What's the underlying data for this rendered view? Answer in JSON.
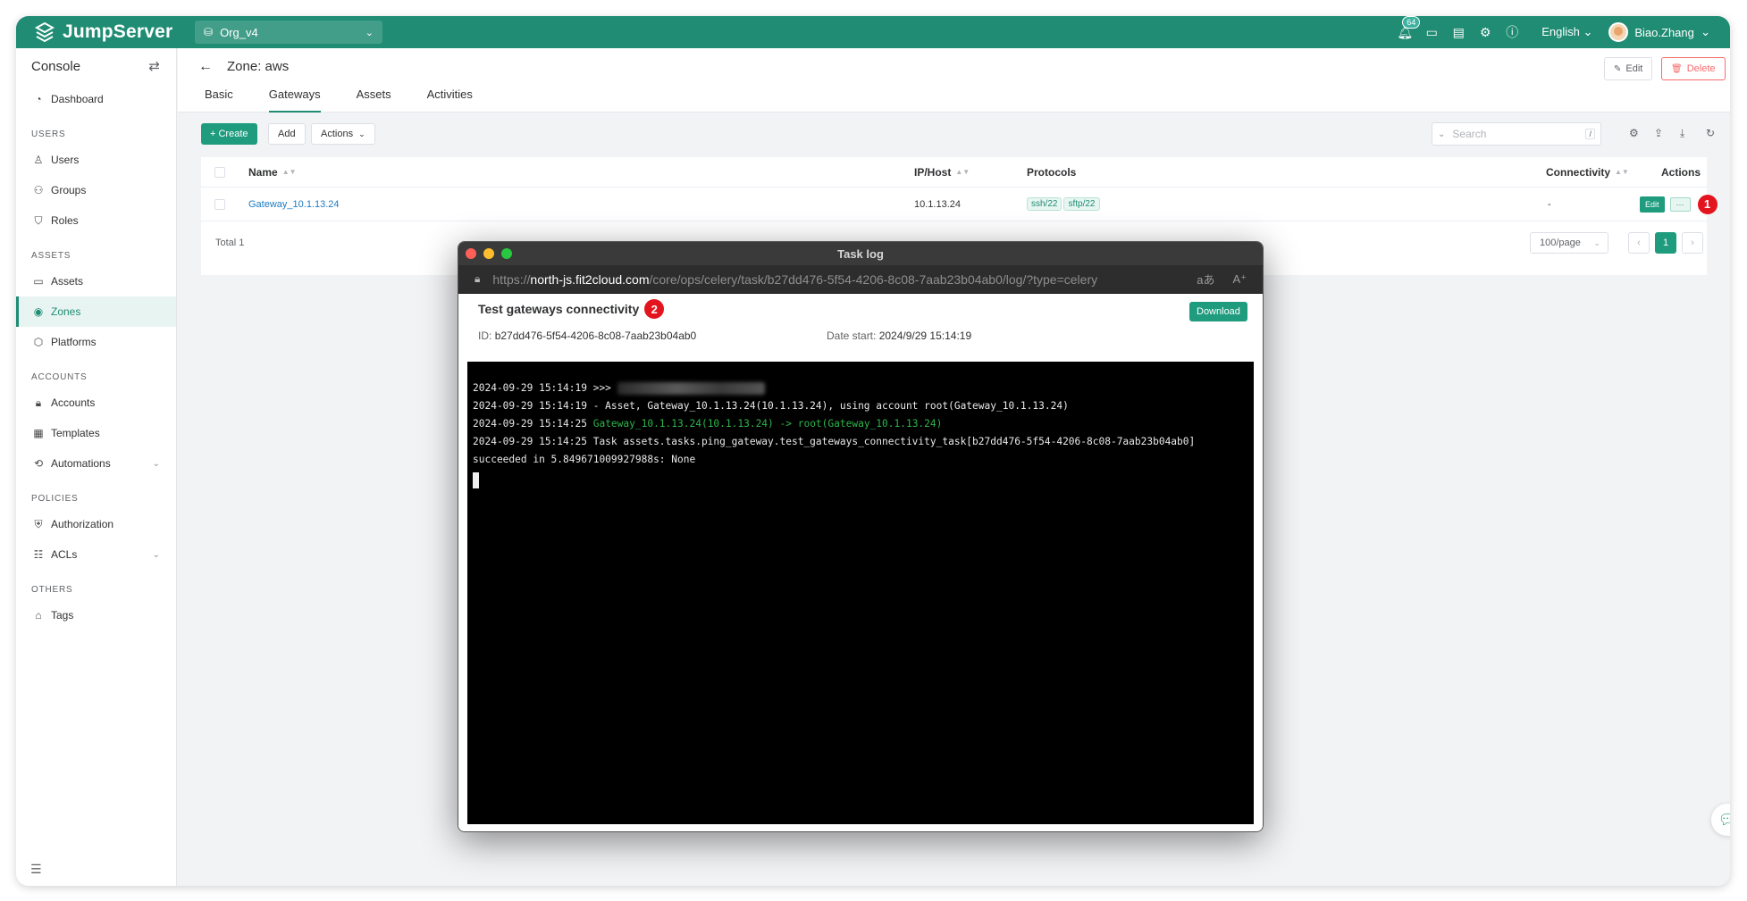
{
  "app": {
    "brand": "JumpServer",
    "org": "Org_v4"
  },
  "topbar": {
    "notification_count": "64",
    "language": "English",
    "user_name": "Biao.Zhang"
  },
  "sidebar": {
    "title": "Console",
    "groups": {
      "users": "USERS",
      "assets": "ASSETS",
      "accounts": "ACCOUNTS",
      "policies": "POLICIES",
      "others": "OTHERS"
    },
    "items": {
      "dashboard": "Dashboard",
      "users": "Users",
      "groups": "Groups",
      "roles": "Roles",
      "assets": "Assets",
      "zones": "Zones",
      "platforms": "Platforms",
      "accounts": "Accounts",
      "templates": "Templates",
      "automations": "Automations",
      "authorization": "Authorization",
      "acls": "ACLs",
      "tags": "Tags"
    }
  },
  "header": {
    "title": "Zone: aws",
    "tabs": [
      "Basic",
      "Gateways",
      "Assets",
      "Activities"
    ],
    "edit_label": "Edit",
    "delete_label": "Delete"
  },
  "toolbar": {
    "create_label": "+ Create",
    "add_label": "Add",
    "actions_label": "Actions",
    "search_placeholder": "Search",
    "search_shortcut": "/"
  },
  "table": {
    "columns": {
      "name": "Name",
      "ip": "IP/Host",
      "protocols": "Protocols",
      "connectivity": "Connectivity",
      "actions": "Actions"
    },
    "rows": [
      {
        "name": "Gateway_10.1.13.24",
        "ip": "10.1.13.24",
        "protocols": [
          "ssh/22",
          "sftp/22"
        ],
        "connectivity": "-",
        "edit": "Edit",
        "more": "···"
      }
    ],
    "total": "Total 1",
    "page_size": "100/page",
    "current_page": "1"
  },
  "markers": {
    "first": "1",
    "second": "2"
  },
  "modal": {
    "window_title": "Task log",
    "url_scheme": "https://",
    "url_host": "north-js.fit2cloud.com",
    "url_path": "/core/ops/celery/task/b27dd476-5f54-4206-8c08-7aab23b04ab0/log/?type=celery",
    "task_title": "Test gateways connectivity",
    "download_label": "Download",
    "id_label": "ID:",
    "id_value": "b27dd476-5f54-4206-8c08-7aab23b04ab0",
    "date_label": "Date start:",
    "date_value": "2024/9/29 15:14:19",
    "log_lines": [
      "2024-09-29 15:14:19 >>> ",
      "2024-09-29 15:14:19 - Asset, Gateway_10.1.13.24(10.1.13.24), using account root(Gateway_10.1.13.24)",
      "2024-09-29 15:14:25 ",
      "Gateway_10.1.13.24(10.1.13.24) -> root(Gateway_10.1.13.24)",
      "2024-09-29 15:14:25 Task assets.tasks.ping_gateway.test_gateways_connectivity_task[b27dd476-5f54-4206-8c08-7aab23b04ab0]",
      "succeeded in 5.849671009927988s: None"
    ]
  }
}
